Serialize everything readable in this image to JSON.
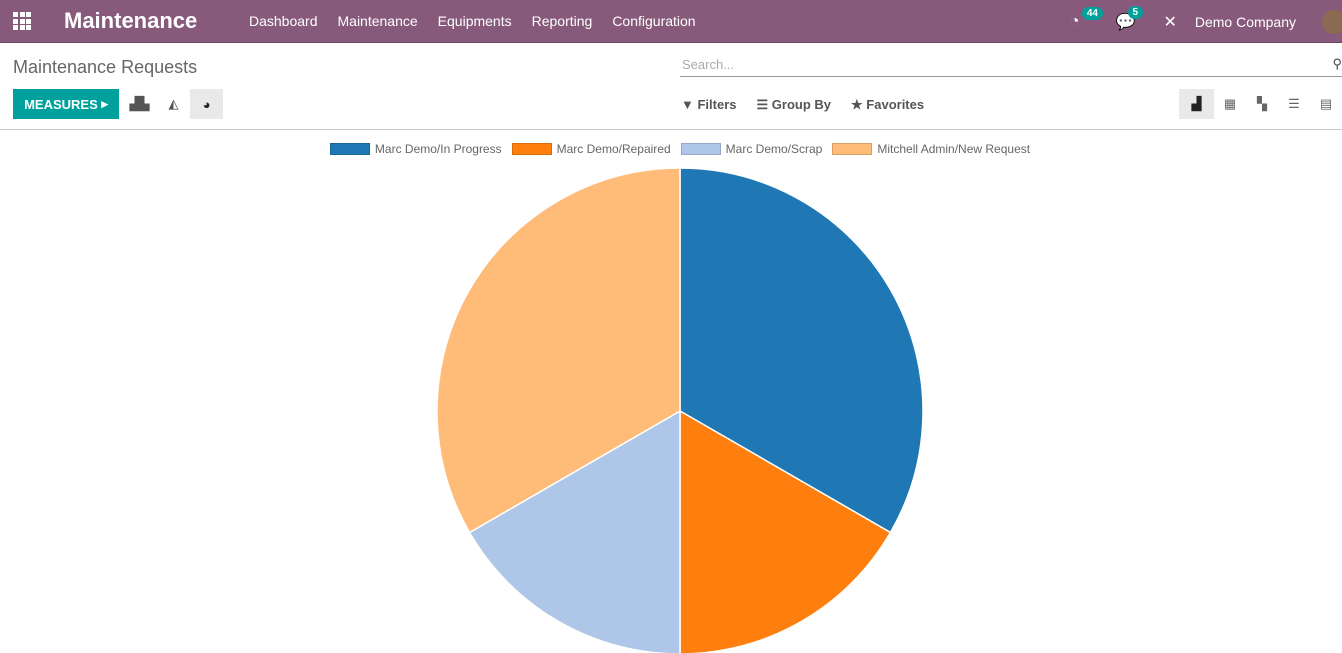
{
  "nav": {
    "brand": "Maintenance",
    "menu": [
      "Dashboard",
      "Maintenance",
      "Equipments",
      "Reporting",
      "Configuration"
    ],
    "activity_count": "44",
    "message_count": "5",
    "company": "Demo Company"
  },
  "page": {
    "title": "Maintenance Requests",
    "search_placeholder": "Search...",
    "measures": "MEASURES",
    "filters": "Filters",
    "group_by": "Group By",
    "favorites": "Favorites"
  },
  "colors": {
    "nav": "#875a7b",
    "primary": "#00a09d"
  },
  "chart_data": {
    "type": "pie",
    "categories": [
      "Marc Demo/In Progress",
      "Marc Demo/Repaired",
      "Marc Demo/Scrap",
      "Mitchell Admin/New Request"
    ],
    "values": [
      2,
      1,
      1,
      2
    ],
    "colors": [
      "#1f77b4",
      "#ff7f0e",
      "#aec7e8",
      "#ffbb78"
    ],
    "legend": "top"
  }
}
